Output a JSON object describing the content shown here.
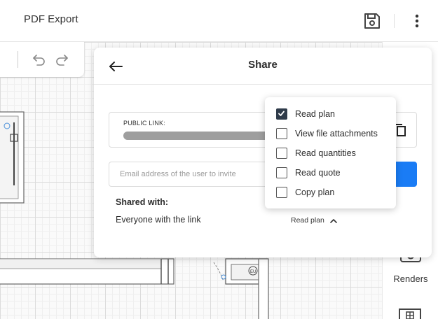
{
  "app": {
    "title": "PDF Export"
  },
  "toolbar": {
    "save_icon": "floppy-disk-icon",
    "more_icon": "vertical-dots-icon"
  },
  "history": {
    "undo_icon": "undo-icon",
    "redo_icon": "redo-icon"
  },
  "rail": {
    "renders_label": "Renders",
    "renders_icon": "camera-icon",
    "plan_icon": "floorplan-icon"
  },
  "share": {
    "title": "Share",
    "public_link_label": "PUBLIC LINK:",
    "email_placeholder": "Email address of the user to invite",
    "shared_with_label": "Shared with:",
    "everyone_label": "Everyone with the link",
    "current_permission": "Read plan",
    "permissions": [
      {
        "label": "Read plan",
        "checked": true
      },
      {
        "label": "View file attachments",
        "checked": false
      },
      {
        "label": "Read quantities",
        "checked": false
      },
      {
        "label": "Read quote",
        "checked": false
      },
      {
        "label": "Copy plan",
        "checked": false
      }
    ]
  },
  "plan": {
    "stair_label": "EU"
  },
  "colors": {
    "accent": "#1a7cf5",
    "checkbox_checked": "#2f3b4a",
    "link_bar": "#9e9e9e"
  }
}
